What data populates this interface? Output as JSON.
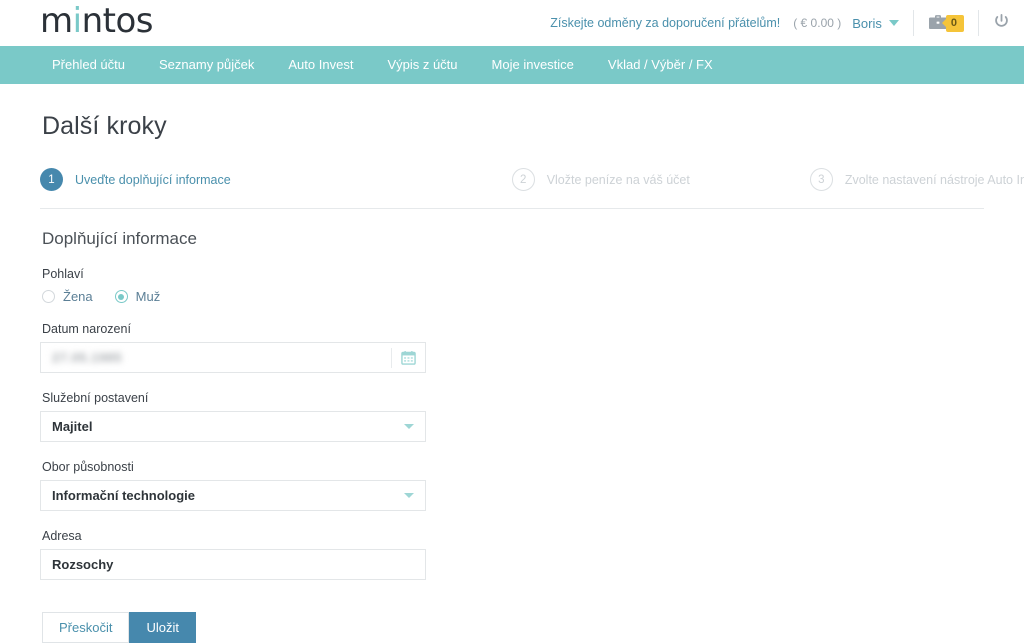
{
  "brand": {
    "logo_pre": "m",
    "logo_i": "i",
    "logo_post": "ntos",
    "nav_color": "#7ac9c8",
    "accent_blue": "#4688ad",
    "link_blue": "#4a90ac",
    "badge_yellow": "#f5c439"
  },
  "header": {
    "refer_link": "Získejte odměny za doporučení přátelům!",
    "balance": "( € 0.00 )",
    "user_name": "Boris",
    "portfolio_count": "0",
    "icons": {
      "caret": "chevron-down-icon",
      "briefcase": "briefcase-icon",
      "power": "power-icon"
    }
  },
  "nav": {
    "items": [
      {
        "label": "Přehled účtu"
      },
      {
        "label": "Seznamy půjček"
      },
      {
        "label": "Auto Invest"
      },
      {
        "label": "Výpis z účtu"
      },
      {
        "label": "Moje investice"
      },
      {
        "label": "Vklad / Výběr / FX"
      }
    ]
  },
  "page": {
    "title": "Další kroky"
  },
  "steps": [
    {
      "number": "1",
      "label": "Uveďte doplňující informace",
      "state": "active"
    },
    {
      "number": "2",
      "label": "Vložte peníze na váš účet",
      "state": "inactive"
    },
    {
      "number": "3",
      "label": "Zvolte nastavení nástroje Auto Invest",
      "state": "inactive"
    }
  ],
  "form": {
    "section_title": "Doplňující informace",
    "gender": {
      "label": "Pohlaví",
      "options": [
        {
          "label": "Žena",
          "checked": false
        },
        {
          "label": "Muž",
          "checked": true
        }
      ]
    },
    "birth_date": {
      "label": "Datum narození",
      "value": "27.05.1985",
      "redacted": true,
      "icon": "calendar-icon"
    },
    "job_position": {
      "label": "Služební postavení",
      "value": "Majitel"
    },
    "industry": {
      "label": "Obor působnosti",
      "value": "Informační technologie"
    },
    "address": {
      "label": "Adresa",
      "value": "Rozsochy"
    },
    "buttons": {
      "skip": "Přeskočit",
      "save": "Uložit"
    }
  }
}
